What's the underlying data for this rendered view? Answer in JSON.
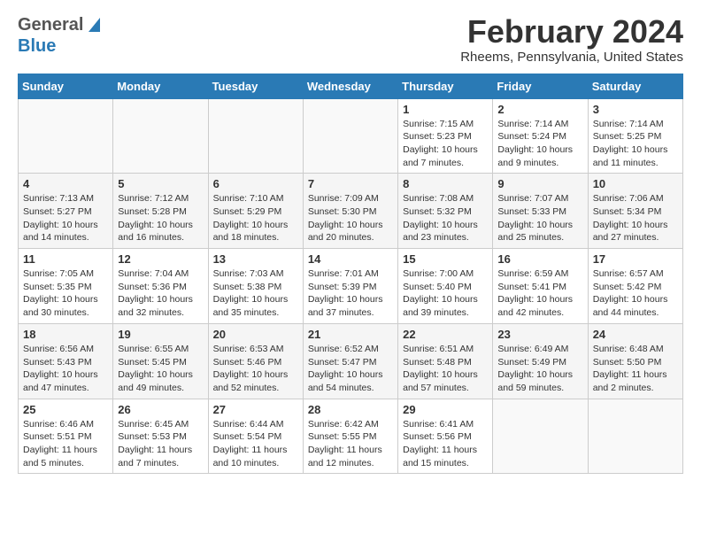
{
  "header": {
    "logo_general": "General",
    "logo_blue": "Blue",
    "month_title": "February 2024",
    "subtitle": "Rheems, Pennsylvania, United States"
  },
  "days_of_week": [
    "Sunday",
    "Monday",
    "Tuesday",
    "Wednesday",
    "Thursday",
    "Friday",
    "Saturday"
  ],
  "weeks": [
    [
      {
        "day": "",
        "info": ""
      },
      {
        "day": "",
        "info": ""
      },
      {
        "day": "",
        "info": ""
      },
      {
        "day": "",
        "info": ""
      },
      {
        "day": "1",
        "info": "Sunrise: 7:15 AM\nSunset: 5:23 PM\nDaylight: 10 hours\nand 7 minutes."
      },
      {
        "day": "2",
        "info": "Sunrise: 7:14 AM\nSunset: 5:24 PM\nDaylight: 10 hours\nand 9 minutes."
      },
      {
        "day": "3",
        "info": "Sunrise: 7:14 AM\nSunset: 5:25 PM\nDaylight: 10 hours\nand 11 minutes."
      }
    ],
    [
      {
        "day": "4",
        "info": "Sunrise: 7:13 AM\nSunset: 5:27 PM\nDaylight: 10 hours\nand 14 minutes."
      },
      {
        "day": "5",
        "info": "Sunrise: 7:12 AM\nSunset: 5:28 PM\nDaylight: 10 hours\nand 16 minutes."
      },
      {
        "day": "6",
        "info": "Sunrise: 7:10 AM\nSunset: 5:29 PM\nDaylight: 10 hours\nand 18 minutes."
      },
      {
        "day": "7",
        "info": "Sunrise: 7:09 AM\nSunset: 5:30 PM\nDaylight: 10 hours\nand 20 minutes."
      },
      {
        "day": "8",
        "info": "Sunrise: 7:08 AM\nSunset: 5:32 PM\nDaylight: 10 hours\nand 23 minutes."
      },
      {
        "day": "9",
        "info": "Sunrise: 7:07 AM\nSunset: 5:33 PM\nDaylight: 10 hours\nand 25 minutes."
      },
      {
        "day": "10",
        "info": "Sunrise: 7:06 AM\nSunset: 5:34 PM\nDaylight: 10 hours\nand 27 minutes."
      }
    ],
    [
      {
        "day": "11",
        "info": "Sunrise: 7:05 AM\nSunset: 5:35 PM\nDaylight: 10 hours\nand 30 minutes."
      },
      {
        "day": "12",
        "info": "Sunrise: 7:04 AM\nSunset: 5:36 PM\nDaylight: 10 hours\nand 32 minutes."
      },
      {
        "day": "13",
        "info": "Sunrise: 7:03 AM\nSunset: 5:38 PM\nDaylight: 10 hours\nand 35 minutes."
      },
      {
        "day": "14",
        "info": "Sunrise: 7:01 AM\nSunset: 5:39 PM\nDaylight: 10 hours\nand 37 minutes."
      },
      {
        "day": "15",
        "info": "Sunrise: 7:00 AM\nSunset: 5:40 PM\nDaylight: 10 hours\nand 39 minutes."
      },
      {
        "day": "16",
        "info": "Sunrise: 6:59 AM\nSunset: 5:41 PM\nDaylight: 10 hours\nand 42 minutes."
      },
      {
        "day": "17",
        "info": "Sunrise: 6:57 AM\nSunset: 5:42 PM\nDaylight: 10 hours\nand 44 minutes."
      }
    ],
    [
      {
        "day": "18",
        "info": "Sunrise: 6:56 AM\nSunset: 5:43 PM\nDaylight: 10 hours\nand 47 minutes."
      },
      {
        "day": "19",
        "info": "Sunrise: 6:55 AM\nSunset: 5:45 PM\nDaylight: 10 hours\nand 49 minutes."
      },
      {
        "day": "20",
        "info": "Sunrise: 6:53 AM\nSunset: 5:46 PM\nDaylight: 10 hours\nand 52 minutes."
      },
      {
        "day": "21",
        "info": "Sunrise: 6:52 AM\nSunset: 5:47 PM\nDaylight: 10 hours\nand 54 minutes."
      },
      {
        "day": "22",
        "info": "Sunrise: 6:51 AM\nSunset: 5:48 PM\nDaylight: 10 hours\nand 57 minutes."
      },
      {
        "day": "23",
        "info": "Sunrise: 6:49 AM\nSunset: 5:49 PM\nDaylight: 10 hours\nand 59 minutes."
      },
      {
        "day": "24",
        "info": "Sunrise: 6:48 AM\nSunset: 5:50 PM\nDaylight: 11 hours\nand 2 minutes."
      }
    ],
    [
      {
        "day": "25",
        "info": "Sunrise: 6:46 AM\nSunset: 5:51 PM\nDaylight: 11 hours\nand 5 minutes."
      },
      {
        "day": "26",
        "info": "Sunrise: 6:45 AM\nSunset: 5:53 PM\nDaylight: 11 hours\nand 7 minutes."
      },
      {
        "day": "27",
        "info": "Sunrise: 6:44 AM\nSunset: 5:54 PM\nDaylight: 11 hours\nand 10 minutes."
      },
      {
        "day": "28",
        "info": "Sunrise: 6:42 AM\nSunset: 5:55 PM\nDaylight: 11 hours\nand 12 minutes."
      },
      {
        "day": "29",
        "info": "Sunrise: 6:41 AM\nSunset: 5:56 PM\nDaylight: 11 hours\nand 15 minutes."
      },
      {
        "day": "",
        "info": ""
      },
      {
        "day": "",
        "info": ""
      }
    ]
  ]
}
